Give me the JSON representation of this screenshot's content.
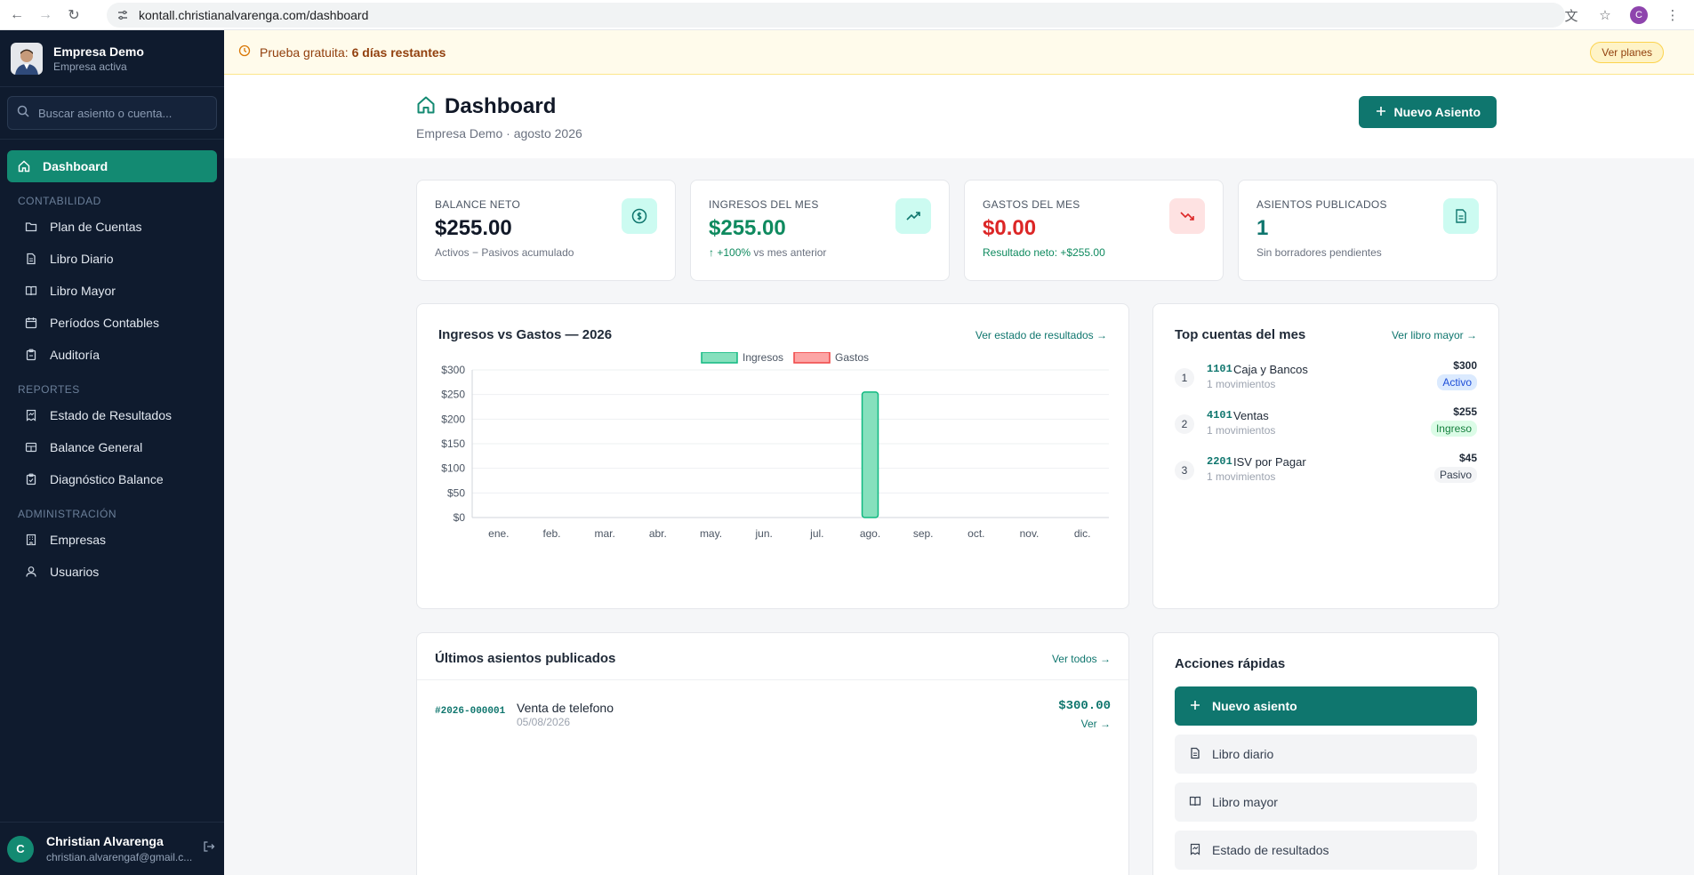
{
  "browser": {
    "url": "kontall.christianalvarenga.com/dashboard",
    "profile_initial": "C"
  },
  "sidebar": {
    "company_name": "Empresa Demo",
    "company_status": "Empresa activa",
    "search_placeholder": "Buscar asiento o cuenta...",
    "items": [
      {
        "label": "Dashboard",
        "icon": "home-icon"
      },
      {
        "label": "Plan de Cuentas",
        "icon": "folder-icon"
      },
      {
        "label": "Libro Diario",
        "icon": "document-icon"
      },
      {
        "label": "Libro Mayor",
        "icon": "book-icon"
      },
      {
        "label": "Períodos Contables",
        "icon": "calendar-icon"
      },
      {
        "label": "Auditoría",
        "icon": "clipboard-icon"
      },
      {
        "label": "Estado de Resultados",
        "icon": "report-icon"
      },
      {
        "label": "Balance General",
        "icon": "scale-icon"
      },
      {
        "label": "Diagnóstico Balance",
        "icon": "clipboard-check-icon"
      },
      {
        "label": "Empresas",
        "icon": "building-icon"
      },
      {
        "label": "Usuarios",
        "icon": "users-icon"
      }
    ],
    "sections": [
      "CONTABILIDAD",
      "REPORTES",
      "ADMINISTRACIÓN"
    ],
    "user": {
      "initial": "C",
      "name": "Christian Alvarenga",
      "email": "christian.alvarengaf@gmail.c..."
    }
  },
  "trial": {
    "text": "Prueba gratuita:",
    "days": "6 días restantes",
    "button": "Ver planes"
  },
  "header": {
    "title": "Dashboard",
    "subtitle": "Empresa Demo · agosto 2026",
    "new_button": "Nuevo Asiento"
  },
  "cards": [
    {
      "label": "BALANCE NETO",
      "value": "$255.00",
      "note": "Activos − Pasivos acumulado",
      "icon": "dollar-icon"
    },
    {
      "label": "INGRESOS DEL MES",
      "value": "$255.00",
      "note_strong": "+100%",
      "note": "vs mes anterior",
      "icon": "trending-up-icon"
    },
    {
      "label": "GASTOS DEL MES",
      "value": "$0.00",
      "note": "Resultado neto: +$255.00",
      "icon": "trending-down-icon"
    },
    {
      "label": "ASIENTOS PUBLICADOS",
      "value": "1",
      "note": "Sin borradores pendientes",
      "icon": "file-icon"
    }
  ],
  "chart_panel": {
    "title": "Ingresos vs Gastos — 2026",
    "link": "Ver estado de resultados →"
  },
  "chart_data": {
    "type": "bar",
    "categories": [
      "ene.",
      "feb.",
      "mar.",
      "abr.",
      "may.",
      "jun.",
      "jul.",
      "ago.",
      "sep.",
      "oct.",
      "nov.",
      "dic."
    ],
    "series": [
      {
        "name": "Ingresos",
        "values": [
          0,
          0,
          0,
          0,
          0,
          0,
          0,
          255,
          0,
          0,
          0,
          0
        ],
        "color": "#86e0bd",
        "stroke": "#10b981"
      },
      {
        "name": "Gastos",
        "values": [
          0,
          0,
          0,
          0,
          0,
          0,
          0,
          0,
          0,
          0,
          0,
          0
        ],
        "color": "#fca5a5",
        "stroke": "#ef4444"
      }
    ],
    "ylim": [
      0,
      300
    ],
    "yticks": [
      "$0",
      "$50",
      "$100",
      "$150",
      "$200",
      "$250",
      "$300"
    ],
    "grid": true,
    "legend": "top-center"
  },
  "top_accounts": {
    "title": "Top cuentas del mes",
    "link": "Ver libro mayor →",
    "rows": [
      {
        "rank": "1",
        "code": "1101",
        "name": "Caja y Bancos",
        "movements": "1 movimientos",
        "amount": "$300",
        "badge": "Activo"
      },
      {
        "rank": "2",
        "code": "4101",
        "name": "Ventas",
        "movements": "1 movimientos",
        "amount": "$255",
        "badge": "Ingreso"
      },
      {
        "rank": "3",
        "code": "2201",
        "name": "ISV por Pagar",
        "movements": "1 movimientos",
        "amount": "$45",
        "badge": "Pasivo"
      }
    ]
  },
  "last_entries": {
    "title": "Últimos asientos publicados",
    "link": "Ver todos →",
    "rows": [
      {
        "id": "#2026-000001",
        "description": "Venta de telefono",
        "date": "05/08/2026",
        "amount": "$300.00",
        "link": "Ver →"
      }
    ]
  },
  "quick_actions": {
    "title": "Acciones rápidas",
    "items": [
      {
        "label": "Nuevo asiento",
        "icon": "plus-icon"
      },
      {
        "label": "Libro diario",
        "icon": "document-icon"
      },
      {
        "label": "Libro mayor",
        "icon": "book-icon"
      },
      {
        "label": "Estado de resultados",
        "icon": "report-icon"
      }
    ]
  }
}
